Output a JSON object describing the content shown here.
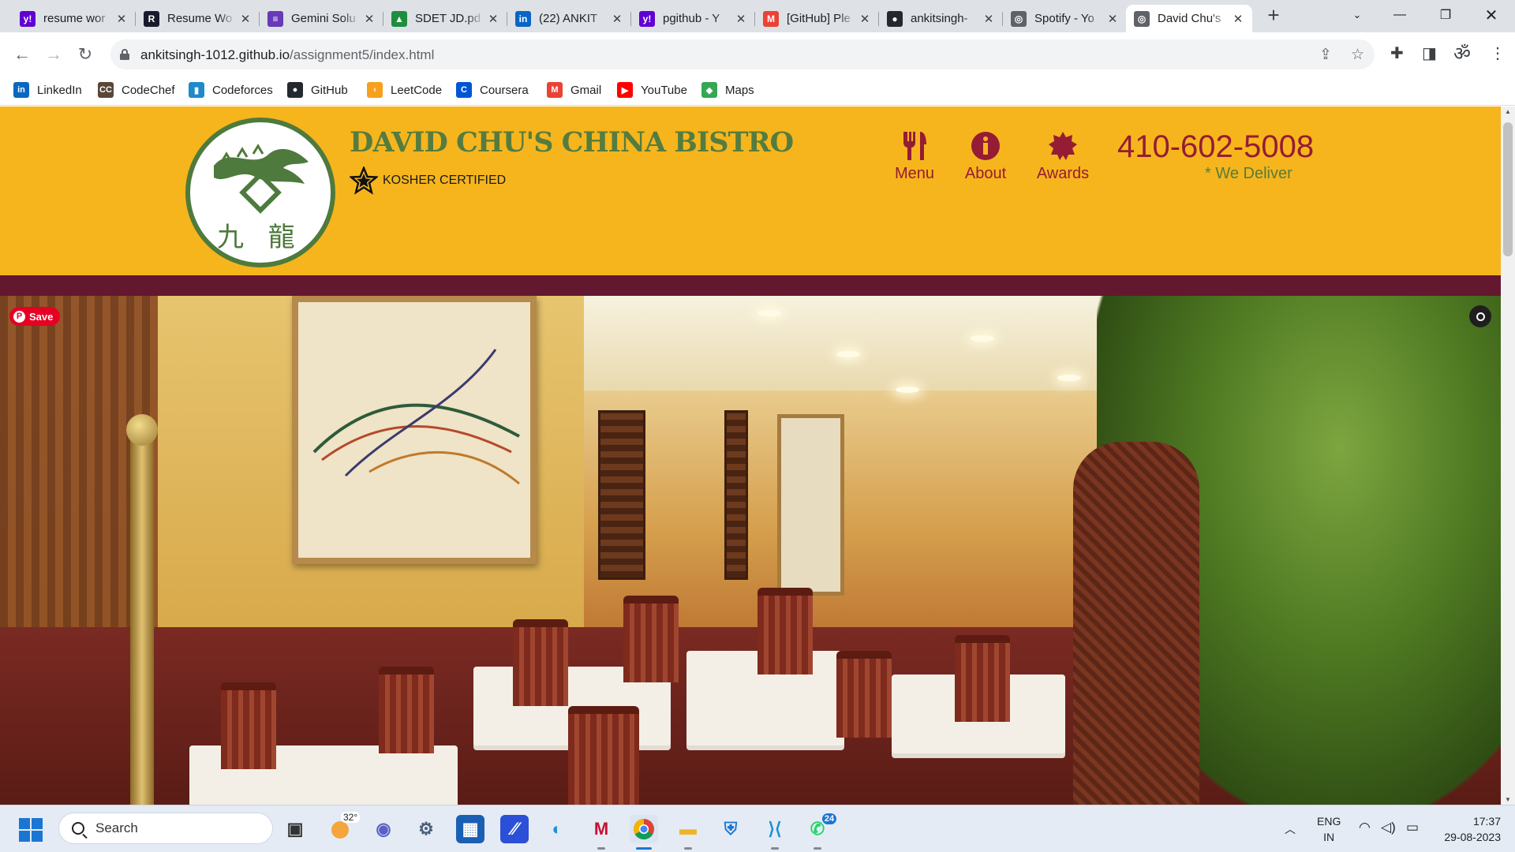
{
  "browser": {
    "tabs": [
      {
        "title": "resume wor",
        "icon": "yahoo-icon",
        "color": "#6001d2"
      },
      {
        "title": "Resume Wo",
        "icon": "resume-worded-icon",
        "color": "#1a1a2e"
      },
      {
        "title": "Gemini Solu",
        "icon": "forms-icon",
        "color": "#673ab7"
      },
      {
        "title": "SDET JD.pd",
        "icon": "google-drive-icon",
        "color": "#1e8e3e"
      },
      {
        "title": "(22) ANKIT",
        "icon": "linkedin-icon",
        "color": "#0a66c2"
      },
      {
        "title": "pgithub - Y",
        "icon": "yahoo-icon",
        "color": "#6001d2"
      },
      {
        "title": "[GitHub] Ple",
        "icon": "gmail-icon",
        "color": "#ea4335"
      },
      {
        "title": "ankitsingh-",
        "icon": "github-icon",
        "color": "#24292f"
      },
      {
        "title": "Spotify - Yo",
        "icon": "globe-icon",
        "color": "#5f6368"
      },
      {
        "title": "David Chu's",
        "icon": "globe-icon",
        "color": "#5f6368"
      }
    ],
    "active_tab": 9,
    "url_host": "ankitsingh-1012.github.io",
    "url_path": "/assignment5/index.html",
    "bookmarks": [
      {
        "label": "LinkedIn",
        "icon": "linkedin-icon",
        "color": "#0a66c2",
        "glyph": "in"
      },
      {
        "label": "CodeChef",
        "icon": "codechef-icon",
        "color": "#5b4638",
        "glyph": "CC"
      },
      {
        "label": "Codeforces",
        "icon": "codeforces-icon",
        "color": "#1f8acb",
        "glyph": "▮"
      },
      {
        "label": "GitHub",
        "icon": "github-icon",
        "color": "#24292f",
        "glyph": "●"
      },
      {
        "label": "LeetCode",
        "icon": "leetcode-icon",
        "color": "#f89f1b",
        "glyph": "‹"
      },
      {
        "label": "Coursera",
        "icon": "coursera-icon",
        "color": "#0056d2",
        "glyph": "C"
      },
      {
        "label": "Gmail",
        "icon": "gmail-icon",
        "color": "#ea4335",
        "glyph": "M"
      },
      {
        "label": "YouTube",
        "icon": "youtube-icon",
        "color": "#ff0000",
        "glyph": "▶"
      },
      {
        "label": "Maps",
        "icon": "maps-icon",
        "color": "#34a853",
        "glyph": "◆"
      }
    ]
  },
  "site": {
    "brand": "DAVID CHU'S CHINA BISTRO",
    "kosher": "KOSHER CERTIFIED",
    "logo_chars": "九 龍",
    "nav": [
      {
        "label": "Menu",
        "icon": "utensils-icon"
      },
      {
        "label": "About",
        "icon": "info-circle-icon"
      },
      {
        "label": "Awards",
        "icon": "award-badge-icon"
      }
    ],
    "phone": "410-602-5008",
    "deliver": "* We Deliver",
    "pin_save": "Save",
    "colors": {
      "header": "#f6b51d",
      "accent": "#951c35",
      "green": "#557c3e",
      "stripe": "#63182f"
    }
  },
  "taskbar": {
    "search": "Search",
    "weather_temp": "32°",
    "whatsapp_badge": "24",
    "lang_top": "ENG",
    "lang_bottom": "IN",
    "time": "17:37",
    "date": "29-08-2023"
  }
}
